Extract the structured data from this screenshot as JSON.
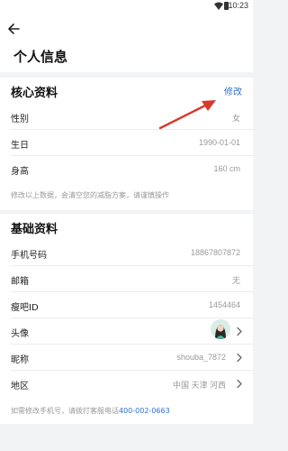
{
  "status": {
    "time": "10:23"
  },
  "header": {
    "title": "个人信息"
  },
  "core": {
    "title": "核心资料",
    "edit_label": "修改",
    "rows": [
      {
        "label": "性别",
        "value": "女"
      },
      {
        "label": "生日",
        "value": "1990-01-01"
      },
      {
        "label": "身高",
        "value": "160 cm"
      }
    ],
    "note": "修改以上数据，会清空您的减脂方案，请谨慎操作"
  },
  "basic": {
    "title": "基础资料",
    "rows": [
      {
        "label": "手机号码",
        "value": "18867807872"
      },
      {
        "label": "邮箱",
        "value": "无"
      },
      {
        "label": "瘦吧ID",
        "value": "1454464"
      },
      {
        "label": "头像"
      },
      {
        "label": "昵称",
        "value": "shouba_7872"
      },
      {
        "label": "地区",
        "value": "中国 天津 河西"
      }
    ],
    "note_prefix": "如需修改手机号，请拨打客服电话",
    "note_phone": "400-002-0663"
  },
  "colors": {
    "accent": "#2f6fd6",
    "arrow": "#d8392b"
  }
}
